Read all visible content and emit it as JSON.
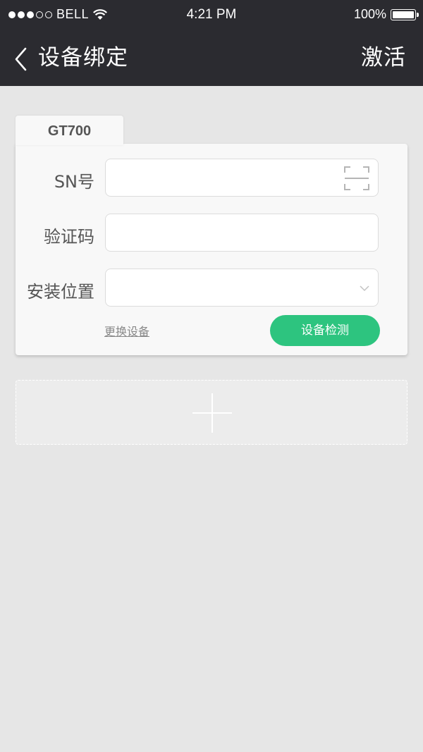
{
  "status_bar": {
    "carrier": "BELL",
    "time": "4:21 PM",
    "battery": "100%",
    "signal_dots": [
      1,
      1,
      1,
      0,
      0
    ]
  },
  "nav": {
    "title": "设备绑定",
    "action": "激活",
    "back_icon": "chevron-left-icon"
  },
  "device_tab": {
    "label": "GT700"
  },
  "form": {
    "sn_label": "SN号",
    "sn_value": "",
    "sn_placeholder": "",
    "code_label": "验证码",
    "code_value": "",
    "code_placeholder": "",
    "location_label": "安装位置",
    "location_value": "",
    "scan_icon": "scan-icon",
    "dropdown_icon": "chevron-down-icon"
  },
  "actions": {
    "replace_device": "更换设备",
    "detect_device": "设备检测"
  },
  "add_device": {
    "icon": "plus-icon"
  },
  "colors": {
    "header_bg": "#2b2b30",
    "page_bg": "#e6e6e6",
    "accent_green": "#2dc47f"
  }
}
